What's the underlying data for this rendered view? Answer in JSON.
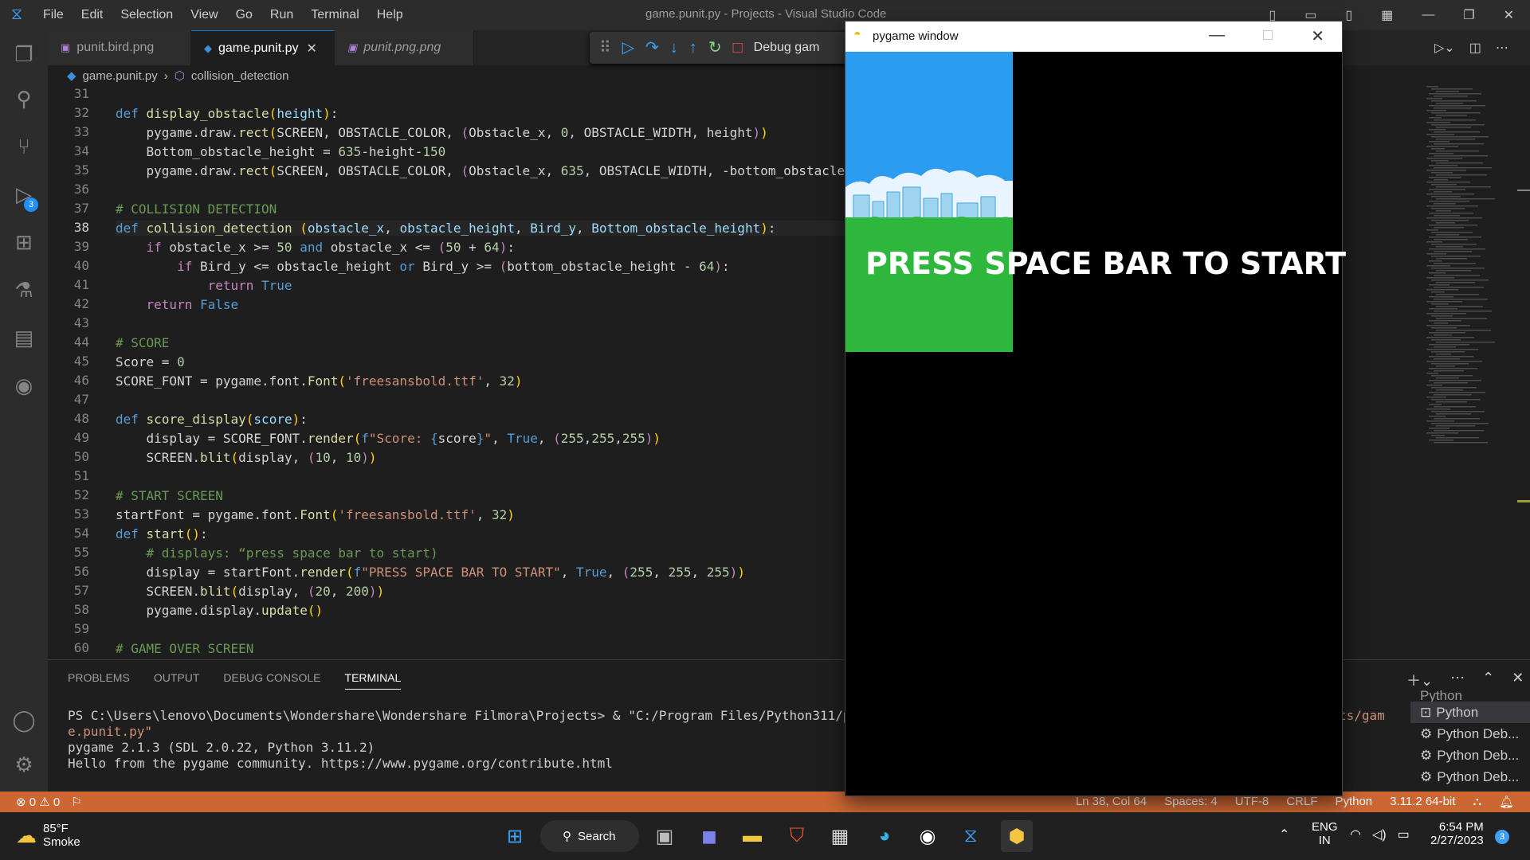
{
  "window": {
    "title": "game.punit.py - Projects - Visual Studio Code"
  },
  "menu": [
    "File",
    "Edit",
    "Selection",
    "View",
    "Go",
    "Run",
    "Terminal",
    "Help"
  ],
  "tabs": [
    {
      "label": "punit.bird.png"
    },
    {
      "label": "game.punit.py"
    },
    {
      "label": "punit.png.png"
    }
  ],
  "debug": {
    "label": "Debug gam"
  },
  "breadcrumb": {
    "file": "game.punit.py",
    "symbol": "collision_detection"
  },
  "activity": {
    "debug_badge": "3"
  },
  "pygame": {
    "title": "pygame window",
    "message": "PRESS SPACE BAR TO START"
  },
  "panel": {
    "tabs": [
      "PROBLEMS",
      "OUTPUT",
      "DEBUG CONSOLE",
      "TERMINAL"
    ],
    "terminal_lines": [
      "PS C:\\Users\\lenovo\\Documents\\Wondershare\\Wondershare Filmora\\Projects> & \"C:/Program Files/Python311/python.e",
      "e.punit.py\"",
      "pygame 2.1.3 (SDL 2.0.22, Python 3.11.2)",
      "Hello from the pygame community. https://www.pygame.org/contribute.html"
    ],
    "terminal_tail": "ts/gam",
    "terminals": [
      "Python",
      "Python",
      "Python Deb...",
      "Python Deb...",
      "Python Deb..."
    ]
  },
  "status": {
    "errors": "0",
    "warnings": "0",
    "position": "Ln 38, Col 64",
    "spaces": "Spaces: 4",
    "encoding": "UTF-8",
    "eol": "CRLF",
    "language": "Python",
    "interpreter": "3.11.2 64-bit"
  },
  "taskbar": {
    "weather_temp": "85°F",
    "weather_desc": "Smoke",
    "search": "Search",
    "lang": "ENG",
    "region": "IN",
    "time": "6:54 PM",
    "date": "2/27/2023",
    "notif": "3"
  },
  "line_numbers": [
    "31",
    "32",
    "33",
    "34",
    "35",
    "36",
    "37",
    "38",
    "39",
    "40",
    "41",
    "42",
    "43",
    "44",
    "45",
    "46",
    "47",
    "48",
    "49",
    "50",
    "51",
    "52",
    "53",
    "54",
    "55",
    "56",
    "57",
    "58",
    "59",
    "60"
  ]
}
